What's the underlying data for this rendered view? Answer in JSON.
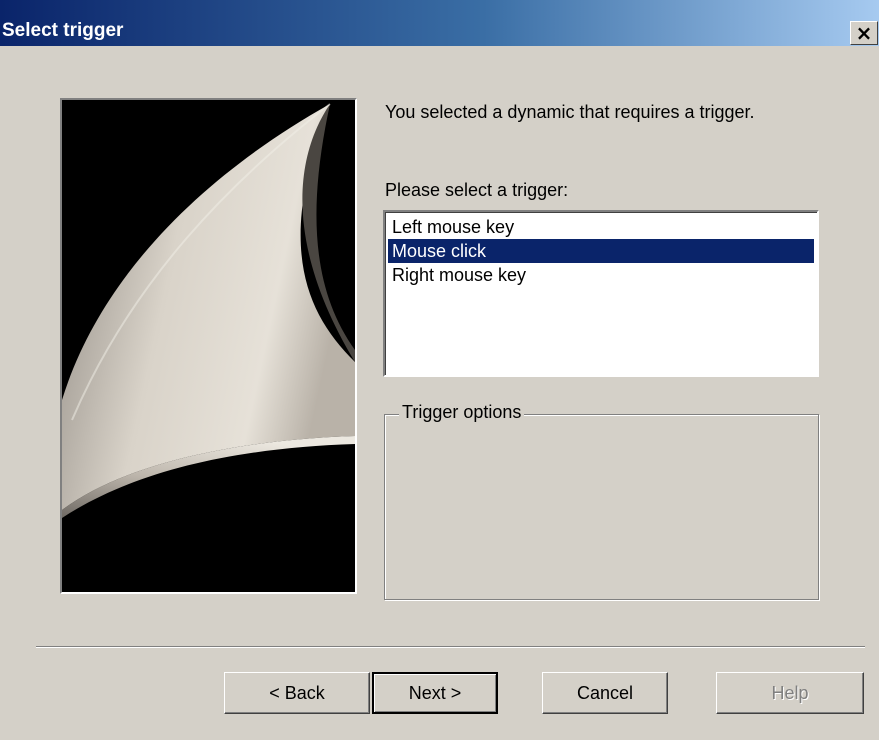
{
  "window": {
    "title": "Select trigger",
    "close_symbol": "×"
  },
  "image": {
    "icon": "decorative-curve-graphic"
  },
  "intro_text": "You selected a dynamic that requires a trigger.",
  "prompt_text": "Please select a trigger:",
  "trigger_list": {
    "items": [
      "Left mouse key",
      "Mouse click",
      "Right mouse key"
    ],
    "selected": "Mouse click"
  },
  "trigger_options": {
    "legend": "Trigger options"
  },
  "buttons": {
    "back": "< Back",
    "next": "Next >",
    "cancel": "Cancel",
    "help": "Help"
  },
  "colors": {
    "selection": "#0a246a",
    "title_gradient_start": "#0a246a",
    "title_gradient_end": "#a6caf0",
    "dialog_face": "#d4d0c8"
  }
}
